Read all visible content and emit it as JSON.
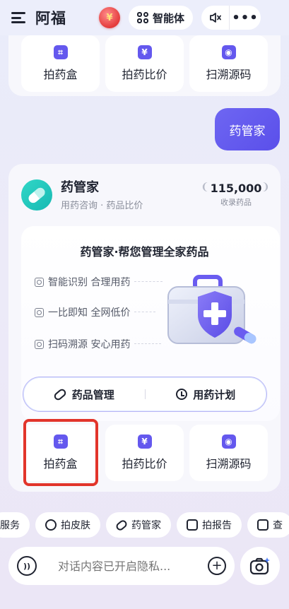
{
  "header": {
    "title": "阿福",
    "redpacket_glyph": "¥",
    "agent_label": "智能体",
    "more_label": "•••"
  },
  "top_tools": [
    {
      "label": "拍药盒",
      "icon": "scan-icon"
    },
    {
      "label": "拍药比价",
      "icon": "yuan-icon"
    },
    {
      "label": "扫溯源码",
      "icon": "target-icon"
    }
  ],
  "user_message": "药管家",
  "assistant_card": {
    "name": "药管家",
    "subtitle": "用药咨询 · 药品比价",
    "stat_value": "115,000",
    "stat_label": "收录药品",
    "panel_title": "药管家·帮您管理全家药品",
    "features": [
      {
        "text": "智能识别 合理用药",
        "icon": "camera-small-icon"
      },
      {
        "text": "一比即知 全网低价",
        "icon": "doc-icon"
      },
      {
        "text": "扫码溯源 安心用药",
        "icon": "scan-small-icon"
      }
    ],
    "modes": [
      {
        "label": "药品管理",
        "icon": "pill-icon"
      },
      {
        "label": "用药计划",
        "icon": "clock-icon"
      }
    ],
    "tools": [
      {
        "label": "拍药盒",
        "icon": "scan-icon"
      },
      {
        "label": "拍药比价",
        "icon": "yuan-icon"
      },
      {
        "label": "扫溯源码",
        "icon": "target-icon"
      }
    ]
  },
  "chips": [
    {
      "label": "服务",
      "icon": "none"
    },
    {
      "label": "拍皮肤",
      "icon": "camera-icon"
    },
    {
      "label": "药管家",
      "icon": "pill-icon"
    },
    {
      "label": "拍报告",
      "icon": "doc-icon"
    },
    {
      "label": "查",
      "icon": "plus-icon"
    }
  ],
  "input": {
    "placeholder": "对话内容已开启隐私..."
  },
  "colors": {
    "accent": "#6458ee",
    "brand_teal": "#1fc4bb",
    "highlight": "#e2352b"
  }
}
